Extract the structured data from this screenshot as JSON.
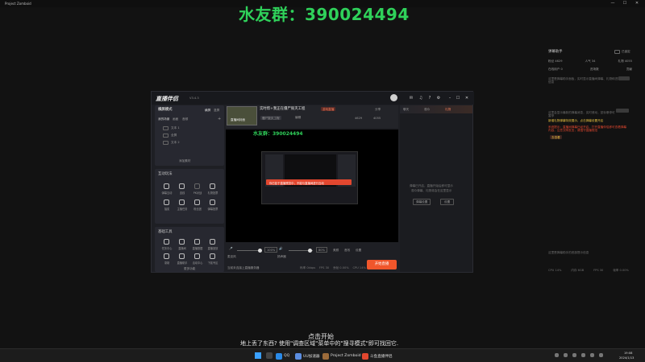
{
  "background_app": {
    "title": "Project Zomboid",
    "controls": [
      "—",
      "☐",
      "✕"
    ]
  },
  "overlay": "水友群：390024494",
  "assistant": {
    "title": "弹幕助手",
    "pin_label": "已锁定",
    "stats_row1": [
      "粉丝 4629",
      "人气 34",
      "礼物 4055"
    ],
    "stats_row2": [
      "在线用户 0",
      "进场数",
      "贡献"
    ],
    "notice": "这里是弹幕助手面板，实时显示直播间弹幕、礼物和进场信息",
    "notice2": "这里会显示最新的弹幕消息，实时滚动，鼠标悬停可暂停",
    "hint_yellow": "新增礼物弹幕特效展示，点击弹幕设置开启",
    "hint_red": "系统提示：直播间弹幕已经开启，打开直播伴侣即可查看弹幕内容，注意文明发言，请遵守直播规范",
    "hint_red_btn": "去查看",
    "bottom_note": "这里是弹幕助手的底部提示信息",
    "metrics": [
      "CPU 14%",
      "内存 6GB",
      "FPS 30",
      "帧率 0.00%"
    ]
  },
  "app": {
    "logo": "直播伴侣",
    "version": "V3.4.3",
    "sidebar": {
      "mode_label": "横屏模式",
      "mode_tabs": [
        "横屏",
        "竖屏"
      ],
      "scene_title": "我的场景",
      "scene_tabs": [
        "画面",
        "音频"
      ],
      "scenes": [
        "文本 1",
        "全屏",
        "文本 2"
      ],
      "add_source": "添加素材",
      "interactive_title": "互动玩法",
      "interactive_items": [
        "弹幕互动",
        "连线",
        "PK对战",
        "礼物投票",
        "抽奖",
        "主播任务",
        "粉丝团",
        "弹幕投票"
      ],
      "tools_title": "基础工具",
      "tools_items": [
        "任务中心",
        "直播间",
        "直播数据",
        "直播回放",
        "录制",
        "直播助手",
        "活动中心",
        "下载专区"
      ],
      "more": "更多功能"
    },
    "stream": {
      "title": "实时帮+我正在僵尸毁灭工程",
      "tag": "游戏直播",
      "edit": "编辑",
      "category": "僵尸毁灭工程",
      "thumb_label": "直播间封面",
      "share": "分享",
      "fans_count": "4629",
      "likes_count": "4055",
      "preview_overlay": "水友群：390024494",
      "preview_warning": "你已处于直播预览中，不能与直播间进行互动"
    },
    "controls": {
      "mic_label": "麦克风",
      "mic_value": "100%",
      "speaker_label": "扬声器",
      "speaker_value": "80%",
      "icons": [
        "美颜",
        "音效",
        "设置"
      ],
      "start": "开始直播",
      "status_text": "当前未连接上直播服务器",
      "bottom_stats": [
        "码率 0kbps",
        "FPS 30",
        "丢帧 0.00%",
        "CPU 14%",
        "内存 6GB",
        "0 分钟"
      ]
    },
    "chat": {
      "tabs": [
        "聊天",
        "观众",
        "礼物"
      ],
      "active_tab": "礼物",
      "empty_text": "弹幕已开启，直播开始后即可显示",
      "empty_sub": "观众弹幕、礼物将会在这里显示",
      "buttons": [
        "弹幕设置",
        "设置"
      ]
    }
  },
  "subtitles": {
    "line1": "点击开始",
    "line2": "地上丢了东西? 使用\"调查区域\"菜单中的\"搜寻模式\"即可找回它."
  },
  "taskbar": {
    "apps": [
      "QQ",
      "UU加速器",
      "Project Zomboid",
      "斗鱼直播伴侣"
    ],
    "time": "19:08",
    "date": "2024/1/13"
  },
  "colors": {
    "accent": "#f0562b",
    "overlay_green": "#2fd15a",
    "warning_red": "#e2472f",
    "hint_yellow": "#e7c140"
  }
}
